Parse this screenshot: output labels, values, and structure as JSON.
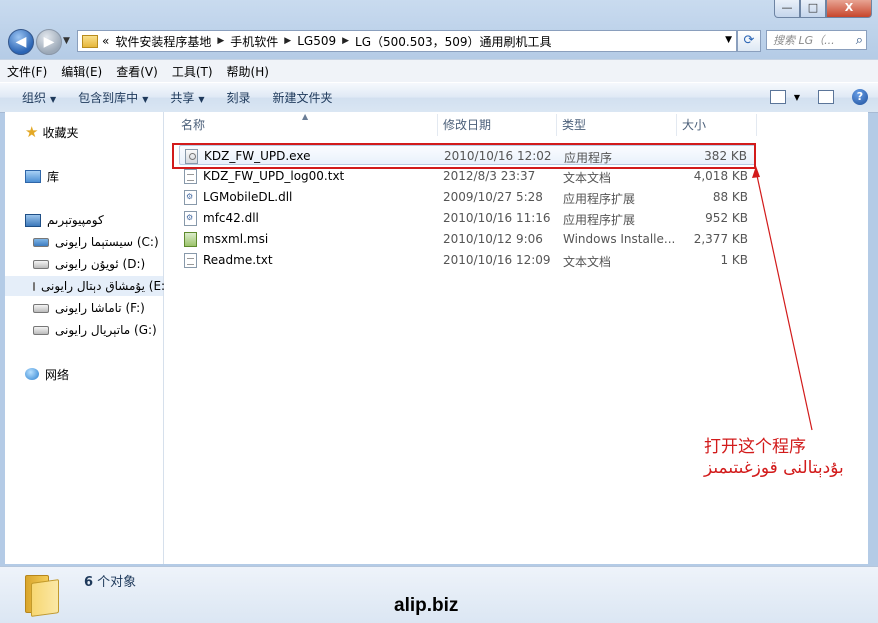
{
  "window": {
    "caption_buttons": {
      "minimize": "—",
      "maximize": "□",
      "close": "X"
    }
  },
  "address": {
    "prefix": "«",
    "crumbs": [
      "软件安装程序基地",
      "手机软件",
      "LG509",
      "LG（500.503，509）通用刷机工具"
    ],
    "search_placeholder": "搜索 LG（..."
  },
  "menu": [
    "文件(F)",
    "编辑(E)",
    "查看(V)",
    "工具(T)",
    "帮助(H)"
  ],
  "commands": {
    "organize": "组织",
    "include_library": "包含到库中",
    "share": "共享",
    "burn": "刻录",
    "new_folder": "新建文件夹"
  },
  "nav": {
    "favorites": "收藏夹",
    "libraries": "库",
    "computer": "كومپيوتېرىم",
    "drives": [
      {
        "label": "سيستېما رايونى (C:)"
      },
      {
        "label": "ئويۇن رايونى (D:)"
      },
      {
        "label": "يۇمشاق دېتال رايونى (E:)"
      },
      {
        "label": "تاماشا رايونى (F:)"
      },
      {
        "label": "ماتېريال رايونى (G:)"
      }
    ],
    "network": "网络"
  },
  "columns": {
    "name": "名称",
    "date": "修改日期",
    "type": "类型",
    "size": "大小"
  },
  "files": [
    {
      "name": "KDZ_FW_UPD.exe",
      "date": "2010/10/16 12:02",
      "type": "应用程序",
      "size": "382 KB",
      "icon": "exe"
    },
    {
      "name": "KDZ_FW_UPD_log00.txt",
      "date": "2012/8/3 23:37",
      "type": "文本文档",
      "size": "4,018 KB",
      "icon": "txt"
    },
    {
      "name": "LGMobileDL.dll",
      "date": "2009/10/27 5:28",
      "type": "应用程序扩展",
      "size": "88 KB",
      "icon": "dll"
    },
    {
      "name": "mfc42.dll",
      "date": "2010/10/16 11:16",
      "type": "应用程序扩展",
      "size": "952 KB",
      "icon": "dll"
    },
    {
      "name": "msxml.msi",
      "date": "2010/10/12 9:06",
      "type": "Windows Installe...",
      "size": "2,377 KB",
      "icon": "msi"
    },
    {
      "name": "Readme.txt",
      "date": "2010/10/16 12:09",
      "type": "文本文档",
      "size": "1 KB",
      "icon": "txt"
    }
  ],
  "annotation": {
    "line1": "打开这个程序",
    "line2": "بۇدېتالنى قوزغىتىمىز",
    "color": "#d21b1b"
  },
  "status": {
    "count": "6",
    "count_label": " 个对象"
  },
  "watermark": "alip.biz"
}
